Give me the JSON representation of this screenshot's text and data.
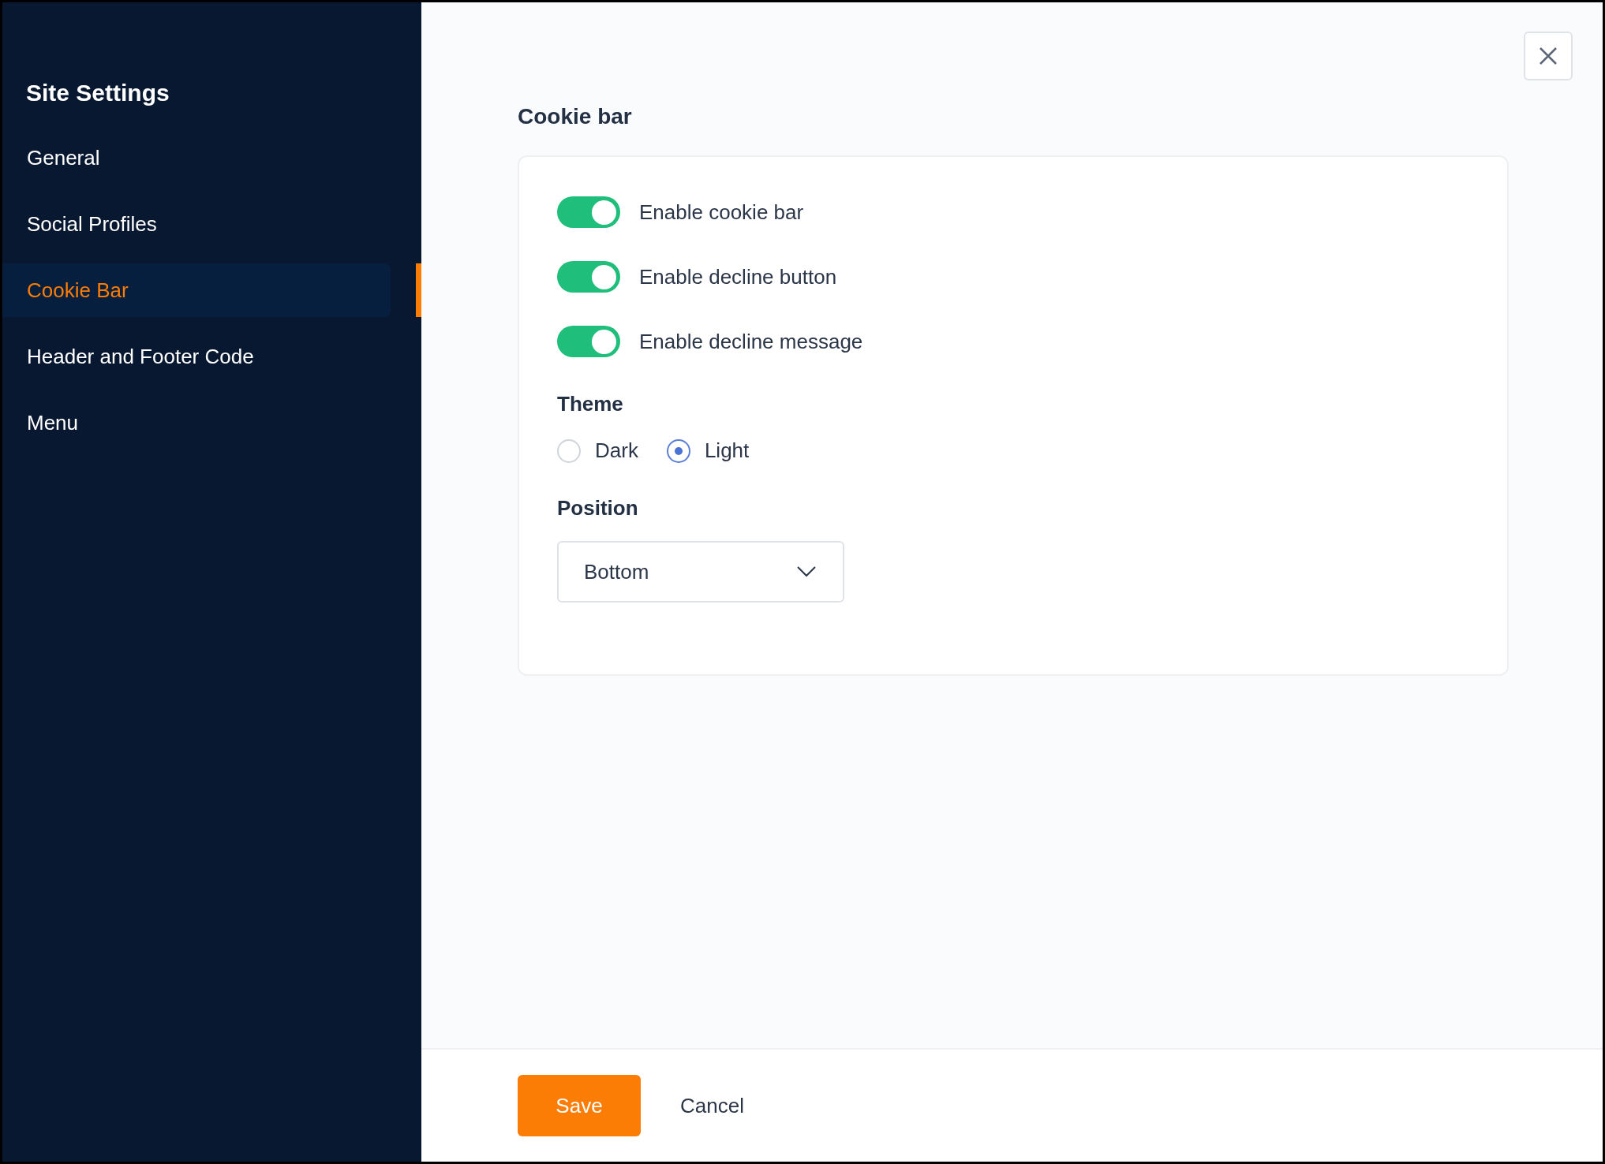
{
  "sidebar": {
    "title": "Site Settings",
    "items": [
      {
        "label": "General",
        "selected": false
      },
      {
        "label": "Social Profiles",
        "selected": false
      },
      {
        "label": "Cookie Bar",
        "selected": true
      },
      {
        "label": "Header and Footer Code",
        "selected": false
      },
      {
        "label": "Menu",
        "selected": false
      }
    ]
  },
  "section": {
    "title": "Cookie bar",
    "toggles": [
      {
        "label": "Enable cookie bar",
        "on": true
      },
      {
        "label": "Enable decline button",
        "on": true
      },
      {
        "label": "Enable decline message",
        "on": true
      }
    ],
    "theme": {
      "label": "Theme",
      "options": [
        {
          "label": "Dark",
          "selected": false
        },
        {
          "label": "Light",
          "selected": true
        }
      ]
    },
    "position": {
      "label": "Position",
      "value": "Bottom"
    }
  },
  "footer": {
    "buttons": [
      {
        "label": "Save",
        "kind": "primary"
      },
      {
        "label": "Cancel",
        "kind": "plain"
      }
    ]
  }
}
